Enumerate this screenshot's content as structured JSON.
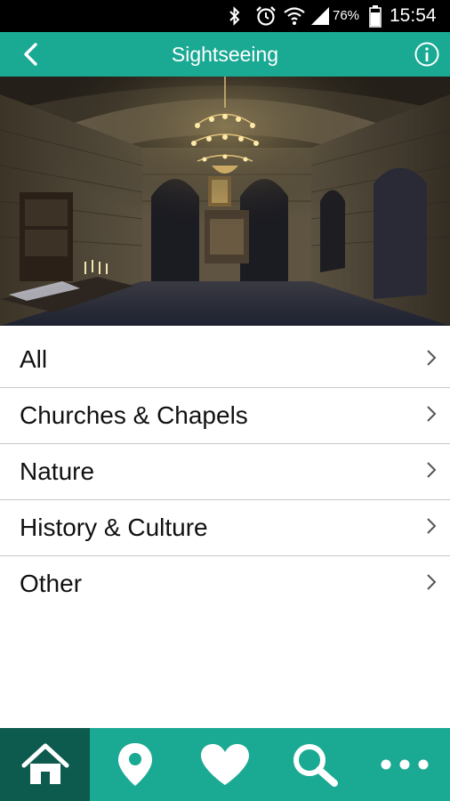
{
  "status_bar": {
    "battery_percent": "76%",
    "time": "15:54",
    "icons": [
      "bluetooth-icon",
      "alarm-icon",
      "wifi-icon",
      "signal-icon",
      "battery-icon"
    ]
  },
  "app_bar": {
    "title": "Sightseeing",
    "back_icon": "back-arrow-icon",
    "info_icon": "info-icon",
    "color": "#1aa993"
  },
  "hero": {
    "description_icon": "photo"
  },
  "categories": [
    {
      "label": "All"
    },
    {
      "label": "Churches & Chapels"
    },
    {
      "label": "Nature"
    },
    {
      "label": "History & Culture"
    },
    {
      "label": "Other"
    }
  ],
  "bottom_nav": {
    "tabs": [
      {
        "icon": "home-icon",
        "active": true
      },
      {
        "icon": "map-pin-icon",
        "active": false
      },
      {
        "icon": "heart-icon",
        "active": false
      },
      {
        "icon": "search-icon",
        "active": false
      },
      {
        "icon": "more-icon",
        "active": false
      }
    ],
    "active_color": "#0d5a4e"
  }
}
